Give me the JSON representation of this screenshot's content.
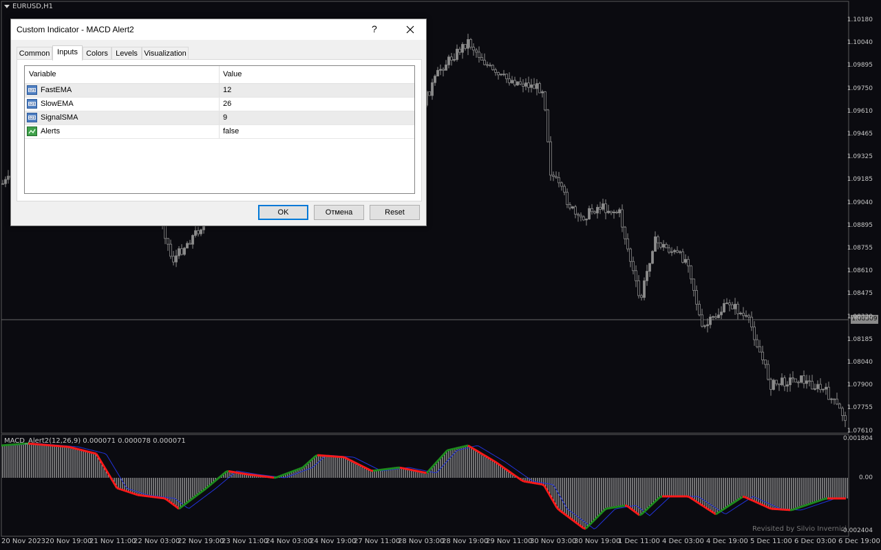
{
  "chart": {
    "symbol": "EURUSD,H1",
    "current_price": "1.08309",
    "price_axis": [
      "1.10180",
      "1.10040",
      "1.09895",
      "1.09750",
      "1.09610",
      "1.09465",
      "1.09325",
      "1.09185",
      "1.09040",
      "1.08895",
      "1.08755",
      "1.08610",
      "1.08475",
      "1.08330",
      "1.08185",
      "1.08040",
      "1.07900",
      "1.07755",
      "1.07610"
    ],
    "time_axis": [
      "20 Nov 2023",
      "20 Nov 19:00",
      "21 Nov 11:00",
      "22 Nov 03:00",
      "22 Nov 19:00",
      "23 Nov 11:00",
      "24 Nov 03:00",
      "24 Nov 19:00",
      "27 Nov 11:00",
      "28 Nov 03:00",
      "28 Nov 19:00",
      "29 Nov 11:00",
      "30 Nov 03:00",
      "30 Nov 19:00",
      "1 Dec 11:00",
      "4 Dec 03:00",
      "4 Dec 19:00",
      "5 Dec 11:00",
      "6 Dec 03:00",
      "6 Dec 19:00"
    ],
    "indicator_title": "MACD_Alert2(12,26,9) 0.000071 0.000078 0.000071",
    "indicator_axis": {
      "top": "0.001804",
      "zero": "0.00",
      "bottom": "-0.002404"
    },
    "credit": "Revisited by Silvio Invernici",
    "colors": {
      "candle": "#8c8c8c",
      "hist": "#d9d9d9",
      "macd_up": "#1e8c1e",
      "macd_down": "#ff1a1a",
      "signal": "#2233dd",
      "background": "#0b0b10"
    }
  },
  "dialog": {
    "title": "Custom Indicator - MACD Alert2",
    "help": "?",
    "tabs": [
      "Common",
      "Inputs",
      "Colors",
      "Levels",
      "Visualization"
    ],
    "active_tab": "Inputs",
    "grid": {
      "headers": {
        "variable": "Variable",
        "value": "Value"
      },
      "rows": [
        {
          "name": "FastEMA",
          "value": "12",
          "icon": "numeric-param-icon"
        },
        {
          "name": "SlowEMA",
          "value": "26",
          "icon": "numeric-param-icon"
        },
        {
          "name": "SignalSMA",
          "value": "9",
          "icon": "numeric-param-icon"
        },
        {
          "name": "Alerts",
          "value": "false",
          "icon": "boolean-param-icon"
        }
      ]
    },
    "buttons": {
      "ok": "OK",
      "cancel": "Отмена",
      "reset": "Reset"
    }
  }
}
